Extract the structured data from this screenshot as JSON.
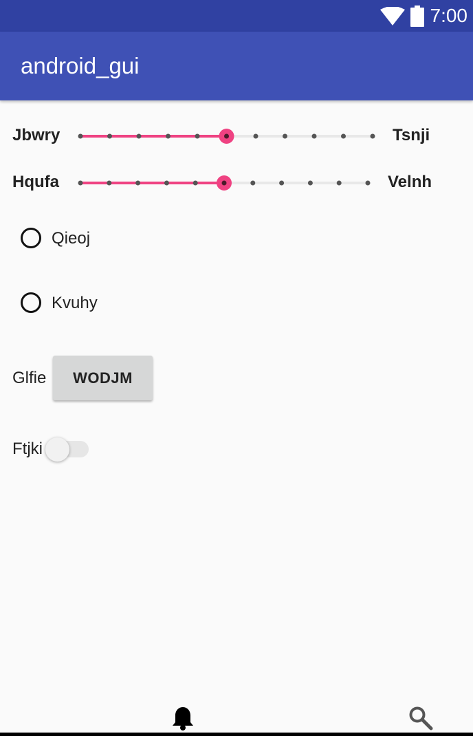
{
  "status_bar": {
    "time": "7:00",
    "wifi_icon": "wifi-icon",
    "battery_icon": "battery-icon"
  },
  "app_bar": {
    "title": "android_gui"
  },
  "sliders": [
    {
      "label_left": "Jbwry",
      "label_right": "Tsnji",
      "steps": 10,
      "value": 5
    },
    {
      "label_left": "Hqufa",
      "label_right": "Velnh",
      "steps": 10,
      "value": 5
    }
  ],
  "radios": [
    {
      "label": "Qieoj",
      "checked": false
    },
    {
      "label": "Kvuhy",
      "checked": false
    }
  ],
  "button_row": {
    "label": "Glfie",
    "button_text": "WODJM"
  },
  "switch_row": {
    "label": "Ftjki",
    "on": false
  },
  "bottom_nav": {
    "items": [
      "bell-icon",
      "search-icon"
    ]
  },
  "colors": {
    "status_bar": "#3041a2",
    "app_bar": "#3f51b5",
    "accent": "#ef4282",
    "background": "#fafafa"
  }
}
